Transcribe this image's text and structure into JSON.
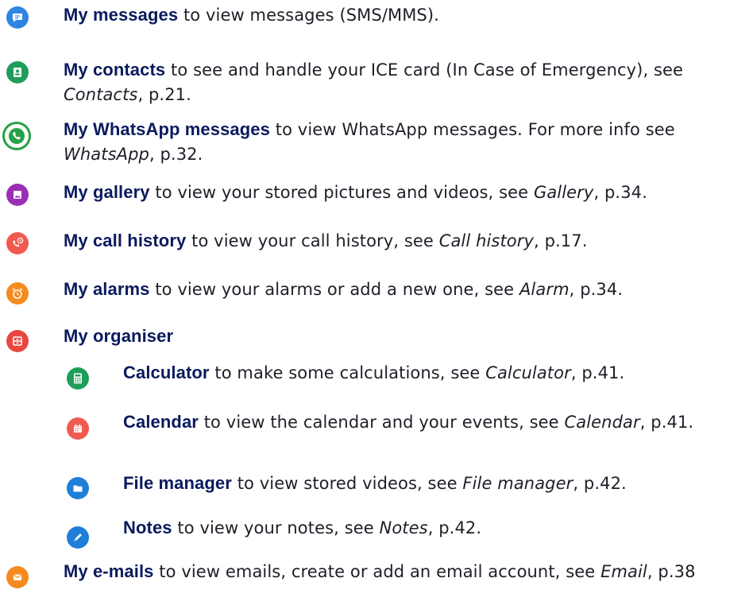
{
  "items": [
    {
      "label": "My messages",
      "desc": " to view messages (SMS/MMS).",
      "ref": "",
      "after": "",
      "icon": "message-icon",
      "color": "#2f86e0"
    },
    {
      "label": "My contacts",
      "desc": " to see and handle your ICE card (In Case of Emergency), see ",
      "ref": "Contacts",
      "after": ", p.21.",
      "icon": "contact-card-icon",
      "color": "#1f9e5a"
    },
    {
      "label": "My WhatsApp messages",
      "desc": " to view WhatsApp messages. For more info see ",
      "ref": "WhatsApp",
      "after": ", p.32.",
      "icon": "whatsapp-icon",
      "color": "#25a244"
    },
    {
      "label": "My gallery",
      "desc": " to view your stored pictures and videos, see ",
      "ref": "Gallery",
      "after": ", p.34.",
      "icon": "gallery-icon",
      "color": "#9a2fb5"
    },
    {
      "label": "My call history",
      "desc": " to view your call history, see ",
      "ref": "Call history",
      "after": ", p.17.",
      "icon": "call-history-icon",
      "color": "#f05a4f"
    },
    {
      "label": "My alarms",
      "desc": " to view your alarms or add a new one, see ",
      "ref": "Alarm",
      "after": ", p.34.",
      "icon": "alarm-clock-icon",
      "color": "#f58a1f"
    },
    {
      "label": "My organiser",
      "desc": "",
      "ref": "",
      "after": "",
      "icon": "organiser-icon",
      "color": "#e8483f"
    },
    {
      "label": "Calculator",
      "desc": " to make some calculations, see ",
      "ref": "Calculator",
      "after": ", p.41.",
      "icon": "calculator-icon",
      "color": "#1f9e5a"
    },
    {
      "label": "Calendar",
      "desc": " to view the calendar and your events, see ",
      "ref": "Calendar",
      "after": ", p.41.",
      "icon": "calendar-icon",
      "color": "#f05a4f"
    },
    {
      "label": "File manager",
      "desc": " to view stored videos, see ",
      "ref": "File manager",
      "after": ", p.42.",
      "icon": "folder-icon",
      "color": "#1f7fd8"
    },
    {
      "label": "Notes",
      "desc": " to view your notes, see ",
      "ref": "Notes",
      "after": ", p.42.",
      "icon": "pencil-icon",
      "color": "#1f7fd8"
    },
    {
      "label": "My e-mails",
      "desc": " to view emails, create or add an email account, see ",
      "ref": "Email",
      "after": ", p.38",
      "icon": "envelope-icon",
      "color": "#f58a1f"
    }
  ]
}
